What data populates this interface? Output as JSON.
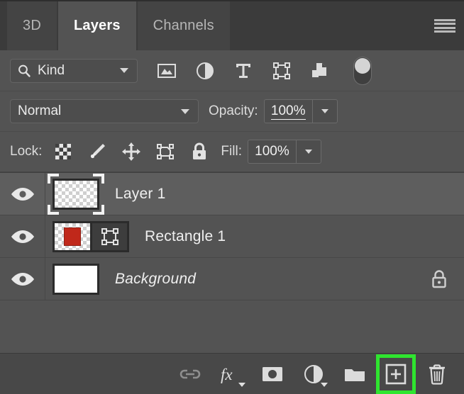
{
  "panel": {
    "title": "Layers",
    "tabs": [
      {
        "label": "3D",
        "active": false
      },
      {
        "label": "Layers",
        "active": true
      },
      {
        "label": "Channels",
        "active": false
      }
    ],
    "menu_icon": "panel-menu-icon"
  },
  "filter": {
    "kind_label": "Kind",
    "search_icon": "search-icon",
    "caret_icon": "chevron-down-icon",
    "icons": [
      "filter-pixel-layers-icon",
      "filter-adjustment-layers-icon",
      "filter-type-layers-icon",
      "filter-shape-layers-icon",
      "filter-smart-object-layers-icon",
      "filter-toggle-switch"
    ]
  },
  "blend": {
    "mode": "Normal",
    "opacity_label": "Opacity:",
    "opacity_value": "100%"
  },
  "lock": {
    "label": "Lock:",
    "icons": [
      "lock-transparent-pixels-icon",
      "lock-image-pixels-icon",
      "lock-position-icon",
      "lock-artboard-nesting-icon",
      "lock-all-icon"
    ],
    "fill_label": "Fill:",
    "fill_value": "100%"
  },
  "layers": [
    {
      "name": "Layer 1",
      "selected": true,
      "visible": true,
      "italic": false,
      "locked": false,
      "thumbnail": "transparent-checker",
      "has_mask": false
    },
    {
      "name": "Rectangle 1",
      "selected": false,
      "visible": true,
      "italic": false,
      "locked": false,
      "thumbnail": "shape-red-rectangle",
      "has_mask": true,
      "shape_color": "#c0281a"
    },
    {
      "name": "Background",
      "selected": false,
      "visible": true,
      "italic": true,
      "locked": true,
      "thumbnail": "white-fill",
      "has_mask": false
    }
  ],
  "bottom_toolbar": {
    "buttons": [
      {
        "name": "link-layers-button",
        "icon": "link-icon",
        "highlighted": false
      },
      {
        "name": "layer-style-button",
        "icon": "fx-icon",
        "highlighted": false
      },
      {
        "name": "add-layer-mask-button",
        "icon": "mask-icon",
        "highlighted": false
      },
      {
        "name": "new-adjustment-layer-button",
        "icon": "adjustment-icon",
        "highlighted": false
      },
      {
        "name": "new-group-button",
        "icon": "folder-icon",
        "highlighted": false
      },
      {
        "name": "new-layer-button",
        "icon": "new-layer-plus-icon",
        "highlighted": true
      },
      {
        "name": "delete-layer-button",
        "icon": "trash-icon",
        "highlighted": false
      }
    ],
    "highlight_color": "#2fe52f"
  },
  "colors": {
    "panel_bg": "#535353",
    "tabbar_bg": "#3b3b3b",
    "tab_inactive_bg": "#444444",
    "selected_row_bg": "#5e5e5e",
    "bottom_bar_bg": "#484848",
    "text": "#efefef",
    "accent_green": "#2fe52f",
    "shape_red": "#c0281a"
  }
}
